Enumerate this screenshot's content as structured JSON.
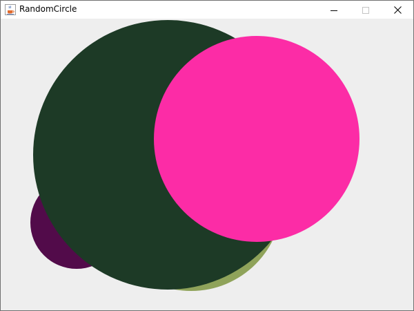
{
  "window": {
    "title": "RandomCircle",
    "icon": "java-cup-icon",
    "controls": {
      "minimize_icon": "minimize-icon",
      "maximize_icon": "maximize-icon",
      "close_icon": "close-icon"
    }
  },
  "canvas": {
    "background": "#eeeeee",
    "circles": [
      {
        "name": "circle-purple",
        "color": "#520b4a"
      },
      {
        "name": "circle-olive",
        "color": "#8fa35a"
      },
      {
        "name": "circle-dark-green",
        "color": "#1d3a26"
      },
      {
        "name": "circle-pink",
        "color": "#fc2ca6"
      }
    ]
  }
}
